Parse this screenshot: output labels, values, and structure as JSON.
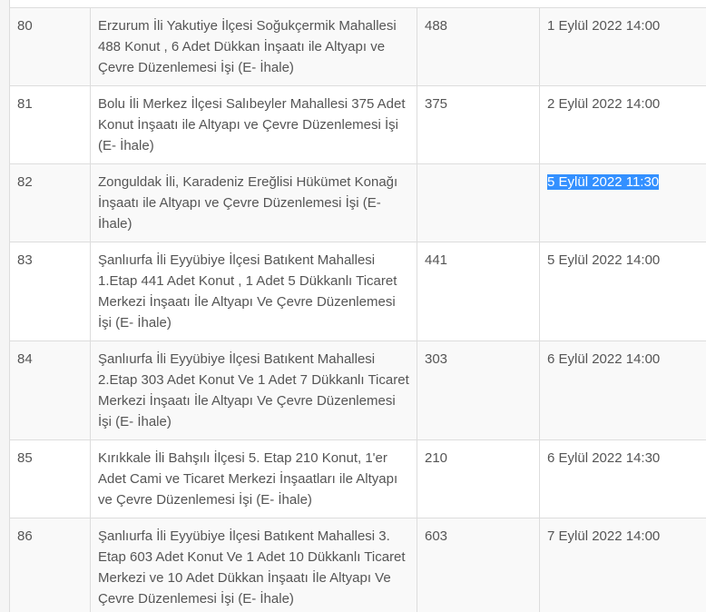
{
  "rows": [
    {
      "no": "80",
      "name": "Erzurum İli Yakutiye İlçesi Soğukçermik Mahallesi 488 Konut , 6 Adet Dükkan İnşaatı ile Altyapı ve Çevre Düzenlemesi İşi (E- İhale)",
      "units": "488",
      "date": "1 Eylül 2022 14:00"
    },
    {
      "no": "81",
      "name": "Bolu İli Merkez İlçesi Salıbeyler Mahallesi 375 Adet Konut İnşaatı ile Altyapı ve Çevre Düzenlemesi İşi (E- İhale)",
      "units": "375",
      "date": "2 Eylül 2022 14:00"
    },
    {
      "no": "82",
      "name": "Zonguldak İli, Karadeniz Ereğlisi Hükümet Konağı İnşaatı ile Altyapı ve Çevre Düzenlemesi İşi (E- İhale)",
      "units": "",
      "date": "5 Eylül 2022 11:30"
    },
    {
      "no": "83",
      "name": "Şanlıurfa İli Eyyübiye İlçesi Batıkent Mahallesi 1.Etap 441 Adet Konut , 1 Adet 5 Dükkanlı Ticaret Merkezi İnşaatı İle Altyapı Ve Çevre Düzenlemesi İşi (E- İhale)",
      "units": "441",
      "date": "5 Eylül 2022 14:00"
    },
    {
      "no": "84",
      "name": "Şanlıurfa İli Eyyübiye İlçesi Batıkent Mahallesi 2.Etap 303 Adet Konut Ve 1 Adet 7 Dükkanlı Ticaret Merkezi İnşaatı İle Altyapı Ve Çevre Düzenlemesi İşi (E- İhale)",
      "units": "303",
      "date": "6 Eylül 2022 14:00"
    },
    {
      "no": "85",
      "name": "Kırıkkale İli Bahşılı İlçesi 5. Etap 210 Konut, 1'er Adet Cami ve Ticaret Merkezi İnşaatları ile Altyapı ve Çevre Düzenlemesi İşi (E- İhale)",
      "units": "210",
      "date": "6 Eylül 2022 14:30"
    },
    {
      "no": "86",
      "name": "Şanlıurfa İli Eyyübiye İlçesi Batıkent Mahallesi 3. Etap 603 Adet Konut Ve 1 Adet 10 Dükkanlı Ticaret Merkezi ve 10 Adet Dükkan İnşaatı İle Altyapı Ve Çevre Düzenlemesi İşi (E- İhale)",
      "units": "603",
      "date": "7 Eylül 2022 14:00"
    }
  ],
  "selection": {
    "row": 2,
    "field": "date"
  }
}
